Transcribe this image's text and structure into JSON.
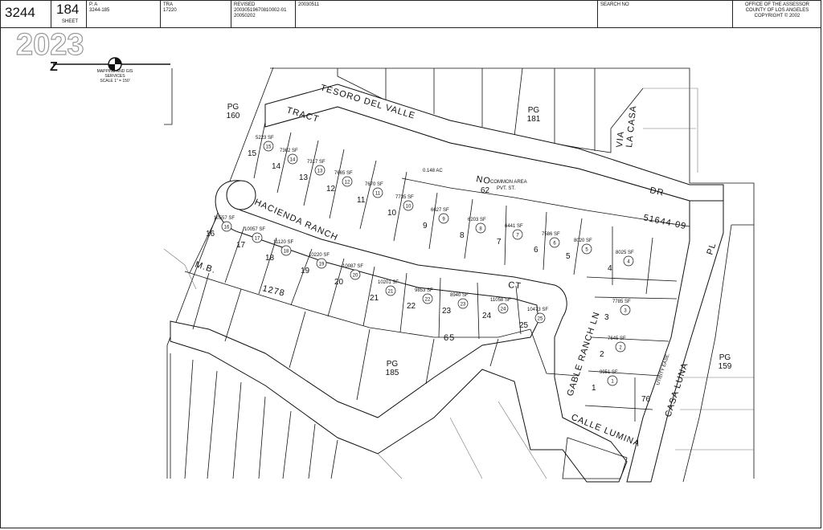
{
  "header": {
    "map_book": "3244",
    "page": "184",
    "sheet_label": "SHEET",
    "pin_label": "P. A",
    "pin_value": "3244-185",
    "tra_label": "TRA",
    "tra_value": "17220",
    "revised_label": "REVISED",
    "revised_line1": "20030519670810002-01",
    "revised_line2": "20050202",
    "revised_code": "20030511",
    "search_label": "SEARCH NO",
    "office_line1": "OFFICE OF THE ASSESSOR",
    "office_line2": "COUNTY OF LOS ANGELES",
    "office_line3": "COPYRIGHT © 2002"
  },
  "watermark": "2023",
  "north_arrow": {
    "z_letter": "Z",
    "caption_line1": "MAPPING AND GIS",
    "caption_line2": "SERVICES",
    "scale": "SCALE 1\" = 150'"
  },
  "pages": {
    "pg160": "PG\n160",
    "pg181": "PG\n181",
    "pg185": "PG\n185",
    "pg159": "PG\n159"
  },
  "streets": {
    "tesoro": "TESORO DEL VALLE",
    "dr": "DR",
    "hacienda": "HACIENDA RANCH",
    "ct": "CT",
    "gable": "GABLE RANCH LN",
    "calle": "CALLE LUMINA",
    "casa_luna": "CASA LUNA",
    "via_la_casa_1": "VIA",
    "via_la_casa_2": "LA CASA",
    "pl": "PL",
    "tract": "TRACT",
    "no": "NO",
    "tract_number": "51644-09",
    "mb": "M.B.",
    "mb_number": "1278",
    "mb_page": "65"
  },
  "lots_north": [
    {
      "n": "15",
      "id": "15",
      "area": "5223 SF"
    },
    {
      "n": "14",
      "id": "14",
      "area": "7362 SF"
    },
    {
      "n": "13",
      "id": "13",
      "area": "7317 SF"
    },
    {
      "n": "12",
      "id": "12",
      "area": "7665 SF"
    },
    {
      "n": "11",
      "id": "11",
      "area": "7670 SF"
    },
    {
      "n": "10",
      "id": "10",
      "area": "7735 SF"
    },
    {
      "n": "9",
      "id": "9",
      "area": "6627 SF"
    },
    {
      "n": "8",
      "id": "8",
      "area": "6203 SF"
    },
    {
      "n": "7",
      "id": "7",
      "area": "6441 SF"
    },
    {
      "n": "6",
      "id": "6",
      "area": "7586 SF"
    },
    {
      "n": "5",
      "id": "5",
      "area": "8020 SF"
    },
    {
      "n": "4",
      "id": "4",
      "area": "8025 SF"
    }
  ],
  "lots_east": [
    {
      "n": "3",
      "id": "3",
      "area": "7785 SF"
    },
    {
      "n": "2",
      "id": "2",
      "area": "7645 SF"
    },
    {
      "n": "1",
      "id": "1",
      "area": "9951 SF"
    }
  ],
  "lots_south": [
    {
      "n": "16",
      "id": "16",
      "area": "10557 SF"
    },
    {
      "n": "17",
      "id": "17",
      "area": "10057 SF"
    },
    {
      "n": "18",
      "id": "18",
      "area": "11120 SF"
    },
    {
      "n": "19",
      "id": "19",
      "area": "10220 SF"
    },
    {
      "n": "20",
      "id": "20",
      "area": "10087 SF"
    },
    {
      "n": "21",
      "id": "21",
      "area": "10201 SF"
    },
    {
      "n": "22",
      "id": "22",
      "area": "9853 SF"
    },
    {
      "n": "23",
      "id": "23",
      "area": "8940 SF"
    },
    {
      "n": "24",
      "id": "24",
      "area": "11058 SF"
    },
    {
      "n": "25",
      "id": "25",
      "area": "10473 SF"
    }
  ],
  "common": {
    "lot_num": "62",
    "area": "0.148 AC",
    "label1": "COMMON AREA",
    "label2": "PVT. ST.",
    "lot76": "76",
    "lot76_label": "UTILITY EASE."
  }
}
